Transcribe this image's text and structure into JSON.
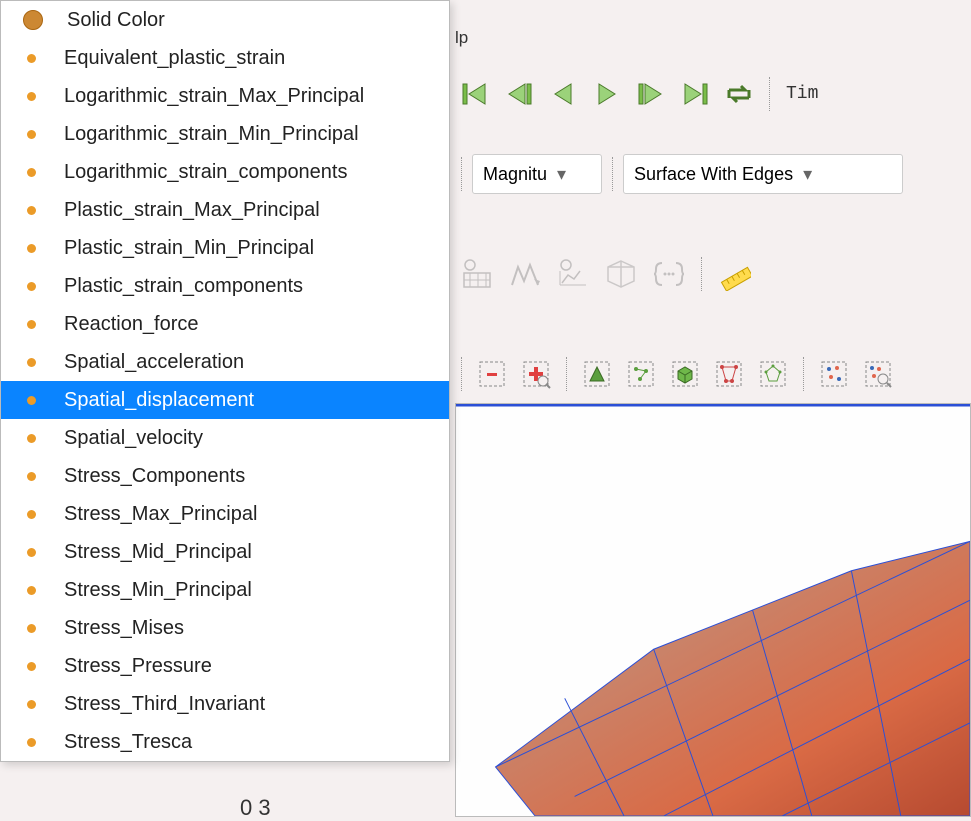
{
  "menubar": {
    "help_fragment": "lp"
  },
  "vcr": {
    "first": "first",
    "stepback": "stepback",
    "play_rev": "play_rev",
    "play_fwd": "play_fwd",
    "stepfwd": "stepfwd",
    "last": "last",
    "loop": "loop"
  },
  "time_label": "Tim",
  "combos": {
    "magnitude": {
      "label": "Magnitu"
    },
    "representation": {
      "label": "Surface With Edges"
    }
  },
  "tool_icons": {
    "time_manager": "time-manager",
    "animation": "animation",
    "warp": "warp",
    "axes": "axes",
    "brackets": "brackets",
    "ruler": "ruler"
  },
  "selection_tools": {
    "remove": "remove-selection",
    "add": "add-selection",
    "tri": "select-triangle",
    "points": "select-points",
    "box": "select-box",
    "frustum": "select-frustum",
    "poly": "select-polygon",
    "scatter1": "select-scatter",
    "scatter2": "select-scatter-zoom"
  },
  "dropdown": {
    "items": [
      {
        "label": "Solid Color",
        "type": "solid",
        "selected": false
      },
      {
        "label": "Equivalent_plastic_strain",
        "type": "point",
        "selected": false
      },
      {
        "label": "Logarithmic_strain_Max_Principal",
        "type": "point",
        "selected": false
      },
      {
        "label": "Logarithmic_strain_Min_Principal",
        "type": "point",
        "selected": false
      },
      {
        "label": "Logarithmic_strain_components",
        "type": "point",
        "selected": false
      },
      {
        "label": "Plastic_strain_Max_Principal",
        "type": "point",
        "selected": false
      },
      {
        "label": "Plastic_strain_Min_Principal",
        "type": "point",
        "selected": false
      },
      {
        "label": "Plastic_strain_components",
        "type": "point",
        "selected": false
      },
      {
        "label": "Reaction_force",
        "type": "point",
        "selected": false
      },
      {
        "label": "Spatial_acceleration",
        "type": "point",
        "selected": false
      },
      {
        "label": "Spatial_displacement",
        "type": "point",
        "selected": true
      },
      {
        "label": "Spatial_velocity",
        "type": "point",
        "selected": false
      },
      {
        "label": "Stress_Components",
        "type": "point",
        "selected": false
      },
      {
        "label": "Stress_Max_Principal",
        "type": "point",
        "selected": false
      },
      {
        "label": "Stress_Mid_Principal",
        "type": "point",
        "selected": false
      },
      {
        "label": "Stress_Min_Principal",
        "type": "point",
        "selected": false
      },
      {
        "label": "Stress_Mises",
        "type": "point",
        "selected": false
      },
      {
        "label": "Stress_Pressure",
        "type": "point",
        "selected": false
      },
      {
        "label": "Stress_Third_Invariant",
        "type": "point",
        "selected": false
      },
      {
        "label": "Stress_Tresca",
        "type": "point",
        "selected": false
      }
    ]
  },
  "axis_tick": "0 3"
}
